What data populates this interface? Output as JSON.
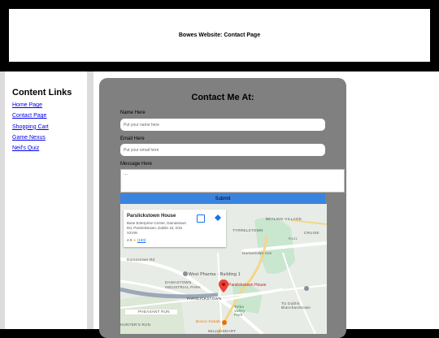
{
  "header": {
    "title": "Bowes Website: Contact Page"
  },
  "sidebar": {
    "title": "Content Links",
    "links": [
      "Home Page",
      "Contact Page",
      "Shopping Cart",
      "Game Nexus",
      "Neil's Quiz"
    ]
  },
  "form": {
    "title": "Contact Me At:",
    "name_label": "Name Here",
    "name_placeholder": "Put your name here",
    "email_label": "Email Here",
    "email_placeholder": "Put your email here",
    "message_label": "Message Here",
    "message_placeholder": "...",
    "submit_label": "Submit"
  },
  "map": {
    "place_name": "Parslickstown House",
    "address": "Base Enterprise Centre, Damastown Rd, Parslickstown, Dublin 15, D15 X2VW",
    "rating": "4.9",
    "reviews": "(160)",
    "pin_label": "Parslickstown House",
    "labels": {
      "bealing": "BEALING VILLAGE",
      "tyrrelstown": "TYRRELSTOWN",
      "cruise": "CRUISE",
      "damastown_ave": "Damastown Ave",
      "damastown_rd": "Damastown Rd",
      "west_pharma": "West Pharma - Building 1",
      "damastown_ip": "DAMASTOWN INDUSTRIAL PARK",
      "parslickstown": "PARSLICKSTOWN",
      "tu_dublin": "TU Dublin Blanchardstown",
      "tolka": "Tolka Valley Park",
      "pheasant": "PHEASANT RUN",
      "hunters": "HUNTER'S RUN",
      "mulhuddart": "MULHUDDART",
      "bosco": "Bosco Kebab",
      "r121": "R121"
    }
  }
}
